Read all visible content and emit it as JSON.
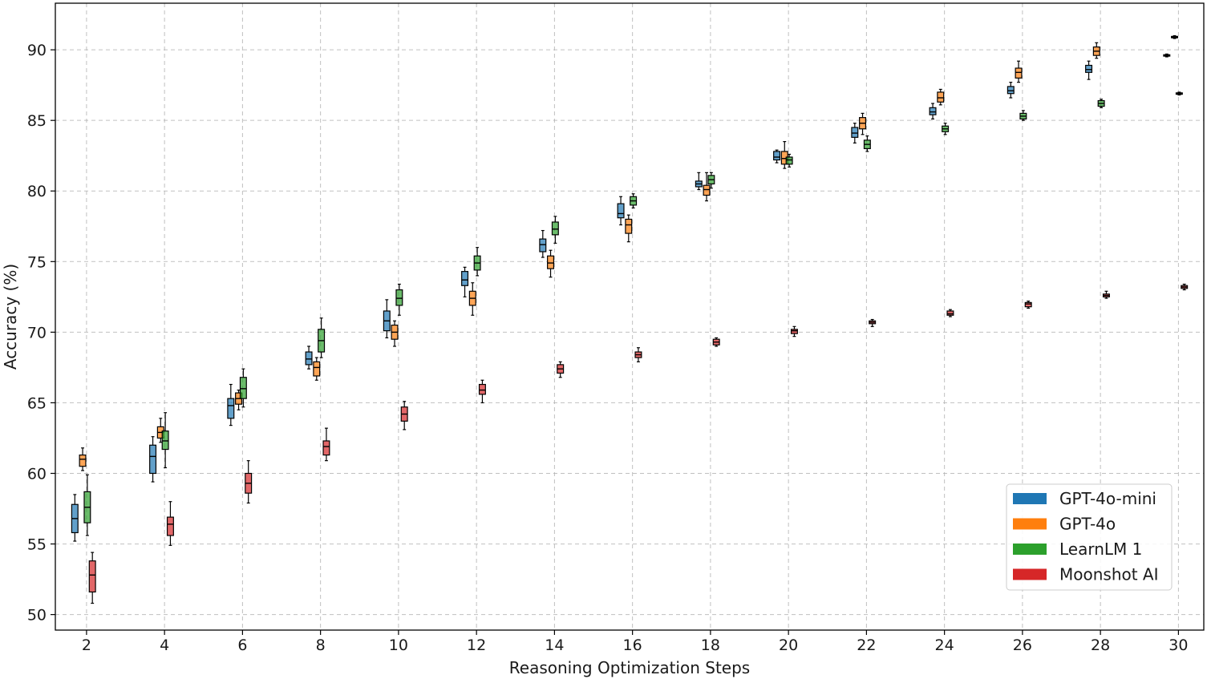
{
  "chart_data": {
    "type": "box",
    "xlabel": "Reasoning Optimization Steps",
    "ylabel": "Accuracy (%)",
    "xlim": [
      1.2,
      30.65
    ],
    "ylim": [
      48.9,
      93.3
    ],
    "xticks": [
      2,
      4,
      6,
      8,
      10,
      12,
      14,
      16,
      18,
      20,
      22,
      24,
      26,
      28,
      30
    ],
    "yticks": [
      50,
      55,
      60,
      65,
      70,
      75,
      80,
      85,
      90
    ],
    "grid": true,
    "legend_position": "bottom-right",
    "series": [
      {
        "name": "GPT-4o-mini",
        "color": "#1f77b4",
        "offset": -0.3,
        "boxes": [
          {
            "x": 2,
            "min": 55.2,
            "q1": 55.8,
            "median": 56.8,
            "q3": 57.8,
            "max": 58.5
          },
          {
            "x": 4,
            "min": 59.4,
            "q1": 60.0,
            "median": 61.2,
            "q3": 62.0,
            "max": 62.6
          },
          {
            "x": 6,
            "min": 63.4,
            "q1": 63.9,
            "median": 64.8,
            "q3": 65.3,
            "max": 66.3
          },
          {
            "x": 8,
            "min": 67.4,
            "q1": 67.7,
            "median": 68.1,
            "q3": 68.6,
            "max": 69.0
          },
          {
            "x": 10,
            "min": 69.6,
            "q1": 70.1,
            "median": 70.8,
            "q3": 71.5,
            "max": 72.3
          },
          {
            "x": 12,
            "min": 72.5,
            "q1": 73.3,
            "median": 73.7,
            "q3": 74.3,
            "max": 74.6
          },
          {
            "x": 14,
            "min": 75.3,
            "q1": 75.7,
            "median": 76.2,
            "q3": 76.6,
            "max": 77.2
          },
          {
            "x": 16,
            "min": 77.6,
            "q1": 78.1,
            "median": 78.4,
            "q3": 79.1,
            "max": 79.6
          },
          {
            "x": 18,
            "min": 80.1,
            "q1": 80.3,
            "median": 80.5,
            "q3": 80.7,
            "max": 81.3
          },
          {
            "x": 20,
            "min": 82.0,
            "q1": 82.2,
            "median": 82.4,
            "q3": 82.8,
            "max": 82.9
          },
          {
            "x": 22,
            "min": 83.4,
            "q1": 83.8,
            "median": 84.1,
            "q3": 84.5,
            "max": 84.8
          },
          {
            "x": 24,
            "min": 85.1,
            "q1": 85.4,
            "median": 85.6,
            "q3": 85.9,
            "max": 86.2
          },
          {
            "x": 26,
            "min": 86.6,
            "q1": 86.9,
            "median": 87.1,
            "q3": 87.4,
            "max": 87.7
          },
          {
            "x": 28,
            "min": 87.9,
            "q1": 88.4,
            "median": 88.6,
            "q3": 88.9,
            "max": 89.2
          },
          {
            "x": 30,
            "min": 89.5,
            "q1": 89.55,
            "median": 89.6,
            "q3": 89.65,
            "max": 89.7
          }
        ]
      },
      {
        "name": "GPT-4o",
        "color": "#ff7f0e",
        "offset": -0.1,
        "boxes": [
          {
            "x": 2,
            "min": 60.2,
            "q1": 60.5,
            "median": 61.0,
            "q3": 61.3,
            "max": 61.8
          },
          {
            "x": 4,
            "min": 62.2,
            "q1": 62.5,
            "median": 62.9,
            "q3": 63.3,
            "max": 63.9
          },
          {
            "x": 6,
            "min": 64.5,
            "q1": 64.9,
            "median": 65.3,
            "q3": 65.7,
            "max": 65.9
          },
          {
            "x": 8,
            "min": 66.6,
            "q1": 66.9,
            "median": 67.5,
            "q3": 67.9,
            "max": 68.2
          },
          {
            "x": 10,
            "min": 69.0,
            "q1": 69.5,
            "median": 70.0,
            "q3": 70.5,
            "max": 70.8
          },
          {
            "x": 12,
            "min": 71.2,
            "q1": 71.9,
            "median": 72.4,
            "q3": 72.9,
            "max": 73.5
          },
          {
            "x": 14,
            "min": 73.9,
            "q1": 74.5,
            "median": 74.9,
            "q3": 75.4,
            "max": 75.8
          },
          {
            "x": 16,
            "min": 76.4,
            "q1": 77.0,
            "median": 77.6,
            "q3": 78.0,
            "max": 78.3
          },
          {
            "x": 18,
            "min": 79.3,
            "q1": 79.7,
            "median": 80.1,
            "q3": 80.4,
            "max": 81.3
          },
          {
            "x": 20,
            "min": 81.6,
            "q1": 81.9,
            "median": 82.3,
            "q3": 82.8,
            "max": 83.5
          },
          {
            "x": 22,
            "min": 84.0,
            "q1": 84.4,
            "median": 84.8,
            "q3": 85.2,
            "max": 85.5
          },
          {
            "x": 24,
            "min": 86.1,
            "q1": 86.3,
            "median": 86.6,
            "q3": 87.0,
            "max": 87.2
          },
          {
            "x": 26,
            "min": 87.7,
            "q1": 88.0,
            "median": 88.4,
            "q3": 88.7,
            "max": 89.2
          },
          {
            "x": 28,
            "min": 89.4,
            "q1": 89.6,
            "median": 89.9,
            "q3": 90.2,
            "max": 90.5
          },
          {
            "x": 30,
            "min": 90.8,
            "q1": 90.85,
            "median": 90.9,
            "q3": 90.95,
            "max": 91.0
          }
        ]
      },
      {
        "name": "LearnLM 1",
        "color": "#2ca02c",
        "offset": 0.02,
        "boxes": [
          {
            "x": 2,
            "min": 55.6,
            "q1": 56.5,
            "median": 57.6,
            "q3": 58.7,
            "max": 59.9
          },
          {
            "x": 4,
            "min": 60.4,
            "q1": 61.7,
            "median": 62.3,
            "q3": 63.0,
            "max": 64.3
          },
          {
            "x": 6,
            "min": 64.7,
            "q1": 65.3,
            "median": 66.0,
            "q3": 66.8,
            "max": 67.4
          },
          {
            "x": 8,
            "min": 68.2,
            "q1": 68.6,
            "median": 69.4,
            "q3": 70.2,
            "max": 71.0
          },
          {
            "x": 10,
            "min": 71.2,
            "q1": 71.9,
            "median": 72.4,
            "q3": 73.0,
            "max": 73.4
          },
          {
            "x": 12,
            "min": 74.0,
            "q1": 74.4,
            "median": 74.9,
            "q3": 75.4,
            "max": 76.0
          },
          {
            "x": 14,
            "min": 76.3,
            "q1": 76.9,
            "median": 77.3,
            "q3": 77.8,
            "max": 78.2
          },
          {
            "x": 16,
            "min": 78.8,
            "q1": 79.0,
            "median": 79.3,
            "q3": 79.6,
            "max": 79.8
          },
          {
            "x": 18,
            "min": 80.2,
            "q1": 80.5,
            "median": 80.8,
            "q3": 81.1,
            "max": 81.3
          },
          {
            "x": 20,
            "min": 81.7,
            "q1": 81.9,
            "median": 82.2,
            "q3": 82.4,
            "max": 82.6
          },
          {
            "x": 22,
            "min": 82.8,
            "q1": 83.0,
            "median": 83.3,
            "q3": 83.6,
            "max": 83.9
          },
          {
            "x": 24,
            "min": 84.0,
            "q1": 84.2,
            "median": 84.4,
            "q3": 84.6,
            "max": 84.8
          },
          {
            "x": 26,
            "min": 85.0,
            "q1": 85.1,
            "median": 85.3,
            "q3": 85.5,
            "max": 85.7
          },
          {
            "x": 28,
            "min": 85.9,
            "q1": 86.0,
            "median": 86.2,
            "q3": 86.4,
            "max": 86.5
          },
          {
            "x": 30,
            "min": 86.8,
            "q1": 86.85,
            "median": 86.9,
            "q3": 86.95,
            "max": 87.0
          }
        ]
      },
      {
        "name": "Moonshot AI",
        "color": "#d62728",
        "offset": 0.15,
        "boxes": [
          {
            "x": 2,
            "min": 50.8,
            "q1": 51.6,
            "median": 52.8,
            "q3": 53.8,
            "max": 54.4
          },
          {
            "x": 4,
            "min": 54.9,
            "q1": 55.6,
            "median": 56.4,
            "q3": 56.9,
            "max": 58.0
          },
          {
            "x": 6,
            "min": 57.9,
            "q1": 58.6,
            "median": 59.3,
            "q3": 60.0,
            "max": 60.9
          },
          {
            "x": 8,
            "min": 60.9,
            "q1": 61.3,
            "median": 61.9,
            "q3": 62.3,
            "max": 63.2
          },
          {
            "x": 10,
            "min": 63.1,
            "q1": 63.7,
            "median": 64.2,
            "q3": 64.7,
            "max": 65.1
          },
          {
            "x": 12,
            "min": 65.0,
            "q1": 65.6,
            "median": 65.9,
            "q3": 66.3,
            "max": 66.6
          },
          {
            "x": 14,
            "min": 66.8,
            "q1": 67.1,
            "median": 67.4,
            "q3": 67.7,
            "max": 67.9
          },
          {
            "x": 16,
            "min": 67.9,
            "q1": 68.2,
            "median": 68.4,
            "q3": 68.6,
            "max": 68.9
          },
          {
            "x": 18,
            "min": 69.0,
            "q1": 69.1,
            "median": 69.3,
            "q3": 69.5,
            "max": 69.6
          },
          {
            "x": 20,
            "min": 69.7,
            "q1": 69.9,
            "median": 70.1,
            "q3": 70.2,
            "max": 70.4
          },
          {
            "x": 22,
            "min": 70.4,
            "q1": 70.6,
            "median": 70.7,
            "q3": 70.8,
            "max": 70.9
          },
          {
            "x": 24,
            "min": 71.1,
            "q1": 71.2,
            "median": 71.3,
            "q3": 71.5,
            "max": 71.6
          },
          {
            "x": 26,
            "min": 71.7,
            "q1": 71.8,
            "median": 72.0,
            "q3": 72.1,
            "max": 72.2
          },
          {
            "x": 28,
            "min": 72.4,
            "q1": 72.5,
            "median": 72.6,
            "q3": 72.7,
            "max": 72.9
          },
          {
            "x": 30,
            "min": 73.0,
            "q1": 73.1,
            "median": 73.2,
            "q3": 73.3,
            "max": 73.4
          }
        ]
      }
    ]
  }
}
